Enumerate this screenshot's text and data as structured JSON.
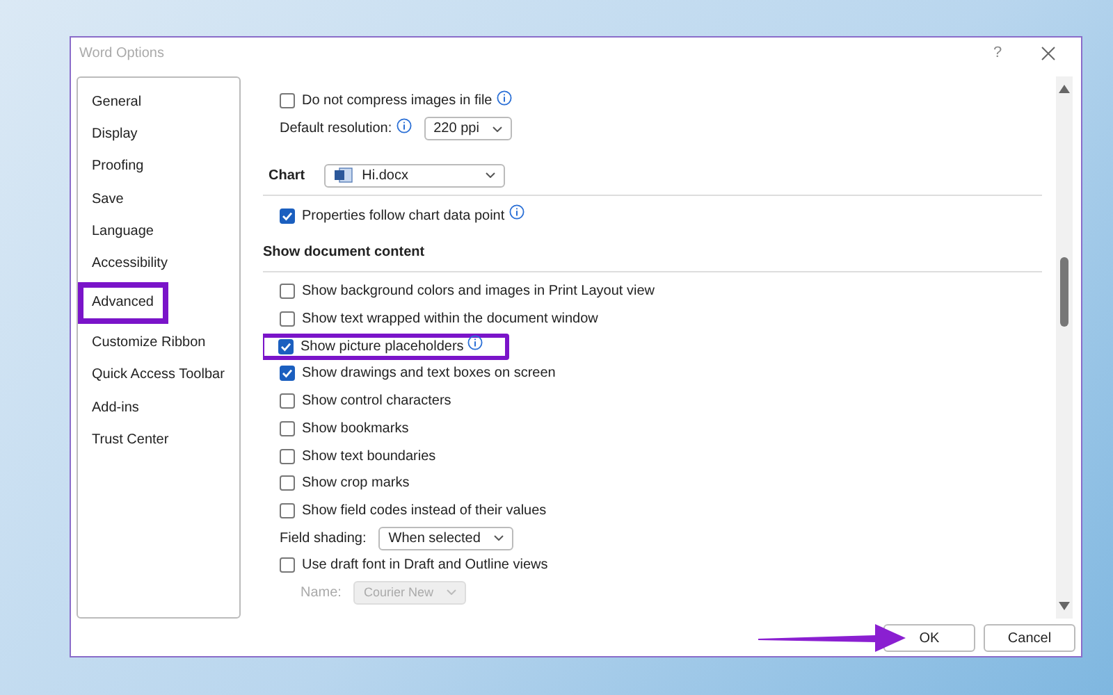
{
  "window": {
    "title": "Word Options",
    "help": "?"
  },
  "sidebar": {
    "items": [
      {
        "label": "General",
        "selected": false,
        "highlighted": false
      },
      {
        "label": "Display",
        "selected": false,
        "highlighted": false
      },
      {
        "label": "Proofing",
        "selected": false,
        "highlighted": false
      },
      {
        "label": "Save",
        "selected": false,
        "highlighted": false
      },
      {
        "label": "Language",
        "selected": false,
        "highlighted": false
      },
      {
        "label": "Accessibility",
        "selected": false,
        "highlighted": false
      },
      {
        "label": "Advanced",
        "selected": true,
        "highlighted": true
      },
      {
        "label": "Customize Ribbon",
        "selected": false,
        "highlighted": false
      },
      {
        "label": "Quick Access Toolbar",
        "selected": false,
        "highlighted": false
      },
      {
        "label": "Add-ins",
        "selected": false,
        "highlighted": false
      },
      {
        "label": "Trust Center",
        "selected": false,
        "highlighted": false
      }
    ]
  },
  "image_options": [
    {
      "kind": "checkbox",
      "label": "Do not compress images in file",
      "checked": false,
      "info": true
    },
    {
      "kind": "dropdown",
      "label": "Default resolution:",
      "value": "220 ppi",
      "info": true,
      "disabled": false
    }
  ],
  "chart": {
    "label": "Chart",
    "value": "Hi.docx",
    "options": [
      {
        "kind": "checkbox",
        "label": "Properties follow chart data point",
        "checked": true,
        "info": true
      }
    ]
  },
  "document_content": {
    "title": "Show document content",
    "options": [
      {
        "kind": "checkbox",
        "label": "Show background colors and images in Print Layout view",
        "checked": false,
        "info": false,
        "highlighted": false
      },
      {
        "kind": "checkbox",
        "label": "Show text wrapped within the document window",
        "checked": false,
        "info": false,
        "highlighted": false
      },
      {
        "kind": "checkbox",
        "label": "Show picture placeholders",
        "checked": true,
        "info": true,
        "highlighted": true
      },
      {
        "kind": "checkbox",
        "label": "Show drawings and text boxes on screen",
        "checked": true,
        "info": false,
        "highlighted": false
      },
      {
        "kind": "checkbox",
        "label": "Show control characters",
        "checked": false,
        "info": false,
        "highlighted": false
      },
      {
        "kind": "checkbox",
        "label": "Show bookmarks",
        "checked": false,
        "info": false,
        "highlighted": false
      },
      {
        "kind": "checkbox",
        "label": "Show text boundaries",
        "checked": false,
        "info": false,
        "highlighted": false
      },
      {
        "kind": "checkbox",
        "label": "Show crop marks",
        "checked": false,
        "info": false,
        "highlighted": false
      },
      {
        "kind": "checkbox",
        "label": "Show field codes instead of their values",
        "checked": false,
        "info": false,
        "highlighted": false
      },
      {
        "kind": "dropdown",
        "label": "Field shading:",
        "value": "When selected",
        "info": false,
        "disabled": false,
        "highlighted": false
      },
      {
        "kind": "checkbox",
        "label": "Use draft font in Draft and Outline views",
        "checked": false,
        "info": false,
        "highlighted": false
      },
      {
        "kind": "dropdown",
        "label": "Name:",
        "value": "Courier New",
        "info": false,
        "disabled": true,
        "highlighted": false
      }
    ]
  },
  "buttons": [
    {
      "label": "OK",
      "pointed": true
    },
    {
      "label": "Cancel",
      "pointed": false
    }
  ]
}
